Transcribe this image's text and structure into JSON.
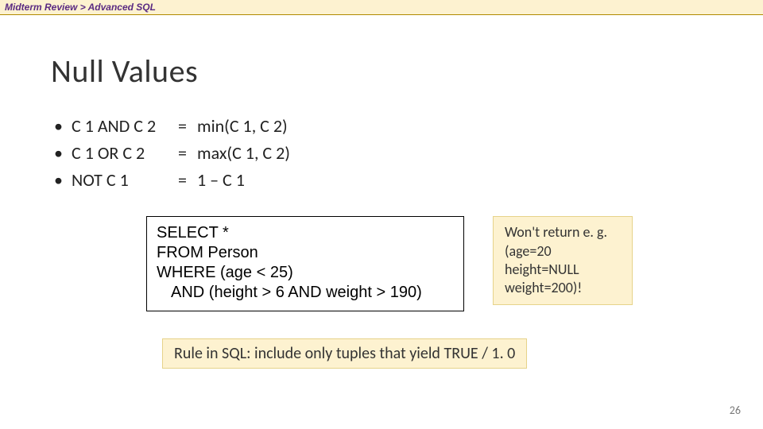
{
  "breadcrumb": {
    "part1": "Midterm Review",
    "sep": ">",
    "part2": "Advanced SQL"
  },
  "title": "Null Values",
  "bullets": [
    {
      "lhs": "C 1 AND C 2",
      "rhs": "min(C 1, C 2)"
    },
    {
      "lhs": "C 1  OR   C 2",
      "rhs": "max(C 1, C 2)"
    },
    {
      "lhs": "NOT C 1",
      "rhs": "1 – C 1"
    }
  ],
  "code": {
    "l1": "SELECT *",
    "l2": "FROM   Person",
    "l3": "WHERE (age < 25)",
    "l4": "AND (height > 6 AND weight > 190)"
  },
  "note": {
    "l1": "Won't return e. g.",
    "l2": "(age=20",
    "l3": "height=NULL",
    "l4": "weight=200)!"
  },
  "rule": "Rule in SQL: include only tuples that yield TRUE / 1. 0",
  "page_number": "26"
}
